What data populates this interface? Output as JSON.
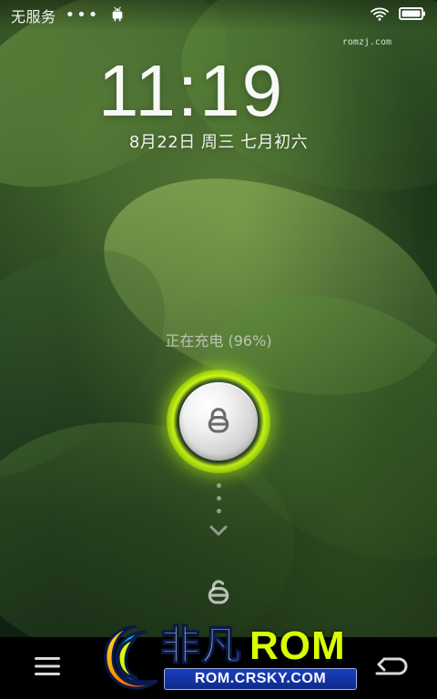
{
  "status_bar": {
    "carrier": "无服务",
    "overflow_dots": "•••"
  },
  "watermark_small": "romzj.com",
  "lockscreen": {
    "time": "11:19",
    "date": "8月22日 周三   七月初六",
    "charging": "正在充电 (96%)"
  },
  "branding": {
    "cn_name": "非凡",
    "rom": "ROM",
    "url": "ROM.CRSKY.COM"
  },
  "colors": {
    "accent_glow": "#c8ff10",
    "brand_yellow": "#d9ff00",
    "brand_blue": "#1b3fbf"
  }
}
